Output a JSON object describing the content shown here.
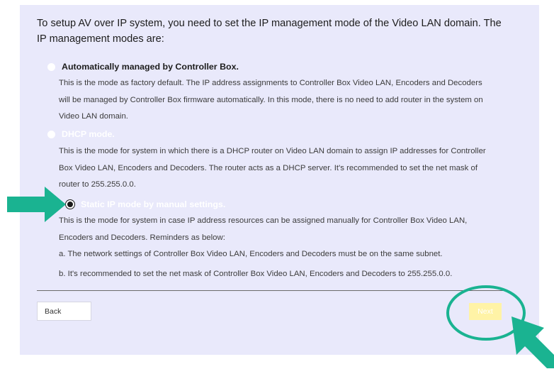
{
  "intro": {
    "text": "To setup AV over IP system, you need to set the IP management mode of the Video LAN domain. The IP management modes are:"
  },
  "options": [
    {
      "label": "Automatically managed by Controller Box.",
      "selected": false,
      "emphasis": "active",
      "description": "This is the mode as factory default. The IP address assignments to Controller Box Video LAN, Encoders and Decoders will be managed by Controller Box firmware automatically. In this mode, there is no need to add router in the system on Video LAN domain."
    },
    {
      "label": "DHCP mode.",
      "selected": false,
      "emphasis": "muted",
      "description": "This is the mode for system in which there is a DHCP router on Video LAN domain to assign IP addresses for Controller Box Video LAN, Encoders and Decoders. The router acts as a DHCP server. It's recommended to set the net mask of router to 255.255.0.0."
    },
    {
      "label": "Static IP mode by manual settings.",
      "selected": true,
      "emphasis": "muted",
      "description": "This is the mode for system in case IP address resources can be assigned manually for Controller Box Video LAN, Encoders and Decoders. Reminders as below:",
      "reminders": [
        "a. The network settings of Controller Box Video LAN, Encoders and Decoders must be on the same subnet.",
        "b. It's recommended to set the net mask of Controller Box Video LAN, Encoders and Decoders to 255.255.0.0."
      ]
    }
  ],
  "buttons": {
    "back_label": "Back",
    "next_label": "Next"
  },
  "colors": {
    "panel_background": "#e9e9fb",
    "annotation_teal": "#1ab391",
    "next_button": "#fff3a6"
  }
}
